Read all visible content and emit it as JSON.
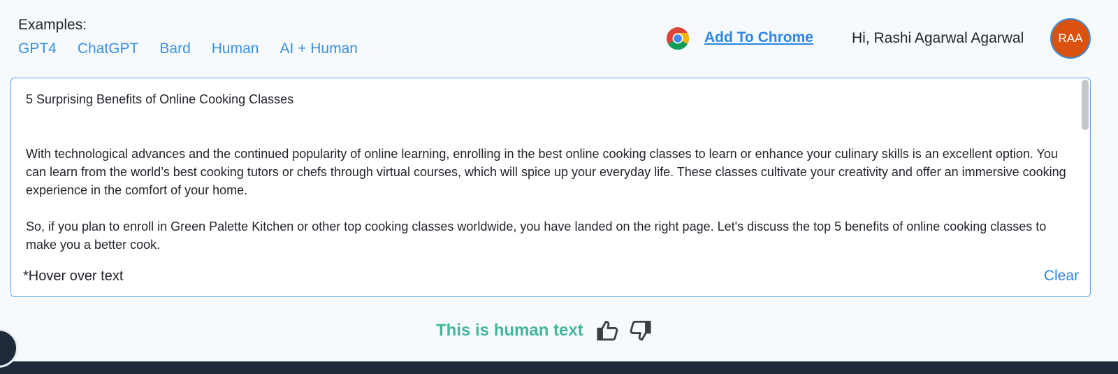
{
  "header": {
    "examples_label": "Examples:",
    "examples": [
      "GPT4",
      "ChatGPT",
      "Bard",
      "Human",
      "AI + Human"
    ],
    "add_to_chrome": "Add To Chrome",
    "greeting": "Hi, Rashi Agarwal Agarwal",
    "avatar_initials": "RAA",
    "avatar_color": "#d9530f"
  },
  "editor": {
    "title": "5 Surprising Benefits of Online Cooking Classes",
    "paragraph1": "With technological advances and the continued popularity of online learning, enrolling in the best online cooking classes to learn or enhance your culinary skills is an excellent option. You can learn from the world’s best cooking tutors or chefs through virtual courses, which will spice up your everyday life. These classes cultivate your creativity and offer an immersive cooking experience in the comfort of your home.",
    "paragraph2": "So, if you plan to enroll in Green Palette Kitchen or other top cooking classes worldwide, you have landed on the right page. Let's discuss the top 5 benefits of online cooking classes to make you a better cook.",
    "hover_note": "*Hover over text",
    "clear_label": "Clear"
  },
  "result": {
    "text": "This is human text",
    "color": "#45b59b"
  },
  "icons": {
    "chrome": "chrome-icon",
    "thumbs_up": "thumbs-up-icon",
    "thumbs_down": "thumbs-down-icon"
  }
}
